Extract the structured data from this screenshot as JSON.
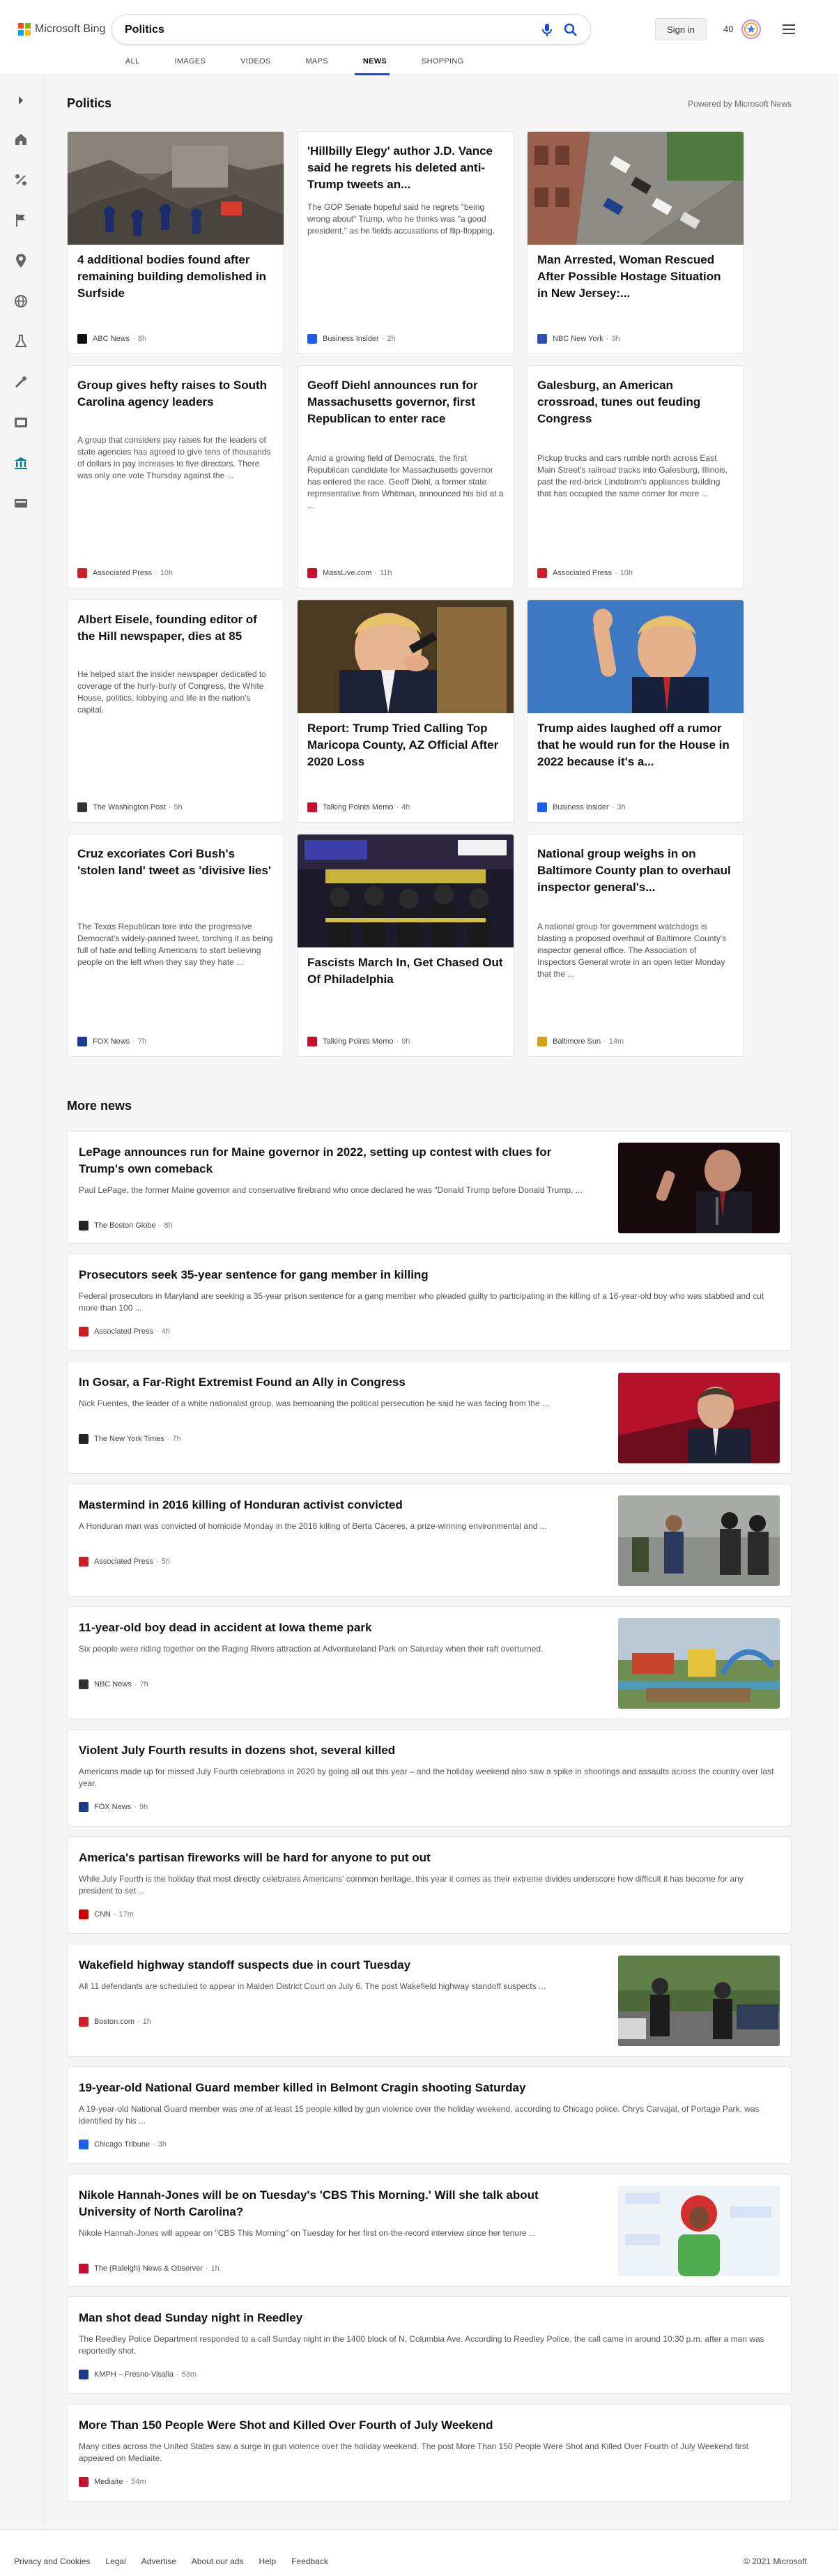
{
  "brand": {
    "name": "Microsoft Bing",
    "logo_colors": [
      "#f25022",
      "#7fba00",
      "#00a4ef",
      "#ffb900"
    ]
  },
  "search": {
    "query": "Politics"
  },
  "header": {
    "signin_label": "Sign in",
    "points": "40"
  },
  "scopes": [
    {
      "label": "ALL"
    },
    {
      "label": "IMAGES"
    },
    {
      "label": "VIDEOS"
    },
    {
      "label": "MAPS"
    },
    {
      "label": "NEWS",
      "active": true
    },
    {
      "label": "SHOPPING"
    }
  ],
  "rail_icons": [
    "expand-icon",
    "home-icon",
    "politics-icon",
    "flag-icon",
    "location-icon",
    "globe-icon",
    "science-icon",
    "sports-icon",
    "entertainment-icon",
    "government-icon",
    "money-icon"
  ],
  "section": {
    "title": "Politics",
    "powered_by": "Powered by Microsoft News"
  },
  "cards": [
    {
      "title": "4 additional bodies found after remaining building demolished in Surfside",
      "snippet": "",
      "source": "ABC News",
      "time": "8h",
      "source_color": "#111111",
      "has_image": true,
      "image": "rubble"
    },
    {
      "title": "'Hillbilly Elegy' author J.D. Vance said he regrets his deleted anti-Trump tweets an...",
      "snippet": "The GOP Senate hopeful said he regrets \"being wrong about\" Trump, who he thinks was \"a good president,\" as he fields accusations of flip-flopping.",
      "source": "Business Insider",
      "time": "2h",
      "source_color": "#1a5ff0",
      "has_image": false
    },
    {
      "title": "Man Arrested, Woman Rescued After Possible Hostage Situation in New Jersey:...",
      "snippet": "",
      "source": "NBC New York",
      "time": "3h",
      "source_color": "#2c4fb6",
      "has_image": true,
      "image": "street"
    },
    {
      "title": "Group gives hefty raises to South Carolina agency leaders",
      "snippet": "A group that considers pay raises for the leaders of state agencies has agreed to give tens of thousands of dollars in pay increases to five directors. There was only one vote Thursday against the ...",
      "source": "Associated Press",
      "time": "10h",
      "source_color": "#d11f2a",
      "has_image": false
    },
    {
      "title": "Geoff Diehl announces run for Massachusetts governor, first Republican to enter race",
      "snippet": "Amid a growing field of Democrats, the first Republican candidate for Massachusetts governor has entered the race. Geoff Diehl, a former state representative from Whitman, announced his bid at a ...",
      "source": "MassLive.com",
      "time": "11h",
      "source_color": "#c8102e",
      "has_image": false
    },
    {
      "title": "Galesburg, an American crossroad, tunes out feuding Congress",
      "snippet": "Pickup trucks and cars rumble north across East Main Street's railroad tracks into Galesburg, Illinois, past the red-brick Lindstrom's appliances building that has occupied the same corner for more ...",
      "source": "Associated Press",
      "time": "10h",
      "source_color": "#d11f2a",
      "has_image": false
    },
    {
      "title": "Albert Eisele, founding editor of the Hill newspaper, dies at 85",
      "snippet": "He helped start the insider newspaper dedicated to coverage of the hurly-burly of Congress, the White House, politics, lobbying and life in the nation's capital.",
      "source": "The Washington Post",
      "time": "5h",
      "source_color": "#333333",
      "has_image": false
    },
    {
      "title": "Report: Trump Tried Calling Top Maricopa County, AZ Official After 2020 Loss",
      "snippet": "",
      "source": "Talking Points Memo",
      "time": "4h",
      "source_color": "#c8102e",
      "has_image": true,
      "image": "phone"
    },
    {
      "title": "Trump aides laughed off a rumor that he would run for the House in 2022 because it's a...",
      "snippet": "",
      "source": "Business Insider",
      "time": "3h",
      "source_color": "#1a5ff0",
      "has_image": true,
      "image": "wave"
    },
    {
      "title": "Cruz excoriates Cori Bush's 'stolen land' tweet as 'divisive lies'",
      "snippet": "The Texas Republican tore into the progressive Democrat's widely-panned tweet, torching it as being full of hate and telling Americans to start believing people on the left when they say they hate ...",
      "source": "FOX News",
      "time": "7h",
      "source_color": "#1a3c8f",
      "has_image": false
    },
    {
      "title": "Fascists March In, Get Chased Out Of Philadelphia",
      "snippet": "",
      "source": "Talking Points Memo",
      "time": "9h",
      "source_color": "#c8102e",
      "has_image": true,
      "image": "march"
    },
    {
      "title": "National group weighs in on Baltimore County plan to overhaul inspector general's...",
      "snippet": "A national group for government watchdogs is blasting a proposed overhaul of Baltimore County's inspector general office. The Association of Inspectors General wrote in an open letter Monday that the ...",
      "source": "Baltimore Sun",
      "time": "14m",
      "source_color": "#d4a017",
      "has_image": false
    }
  ],
  "more_news": {
    "title": "More news"
  },
  "news": [
    {
      "title": "LePage announces run for Maine governor in 2022, setting up contest with clues for Trump's own comeback",
      "snippet": "Paul LePage, the former Maine governor and conservative firebrand who once declared he was \"Donald Trump before Donald Trump, ...",
      "source": "The Boston Globe",
      "time": "8h",
      "source_color": "#222222",
      "image": "speaker"
    },
    {
      "title": "Prosecutors seek 35-year sentence for gang member in killing",
      "snippet": "Federal prosecutors in Maryland are seeking a 35-year prison sentence for a gang member who pleaded guilty to participating in the killing of a 16-year-old boy who was stabbed and cut more than 100 ...",
      "source": "Associated Press",
      "time": "4h",
      "source_color": "#d11f2a",
      "image": ""
    },
    {
      "title": "In Gosar, a Far-Right Extremist Found an Ally in Congress",
      "snippet": "Nick Fuentes, the leader of a white nationalist group, was bemoaning the political persecution he said he was facing from the ...",
      "source": "The New York Times",
      "time": "7h",
      "source_color": "#222222",
      "image": "gosar"
    },
    {
      "title": "Mastermind in 2016 killing of Honduran activist convicted",
      "snippet": "A Honduran man was convicted of homicide Monday in the 2016 killing of Berta Cáceres, a prize-winning environmental and ...",
      "source": "Associated Press",
      "time": "5h",
      "source_color": "#d11f2a",
      "image": "honduras"
    },
    {
      "title": "11-year-old boy dead in accident at Iowa theme park",
      "snippet": "Six people were riding together on the Raging Rivers attraction at Adventureland Park on Saturday when their raft overturned.",
      "source": "NBC News",
      "time": "7h",
      "source_color": "#333333",
      "image": "park"
    },
    {
      "title": "Violent July Fourth results in dozens shot, several killed",
      "snippet": "Americans made up for missed July Fourth celebrations in 2020 by going all out this year – and the holiday weekend also saw a spike in shootings and assaults across the country over last year.",
      "source": "FOX News",
      "time": "9h",
      "source_color": "#1a3c8f",
      "image": ""
    },
    {
      "title": "America's partisan fireworks will be hard for anyone to put out",
      "snippet": "While July Fourth is the holiday that most directly celebrates Americans' common heritage, this year it comes as their extreme divides underscore how difficult it has become for any president to set ...",
      "source": "CNN",
      "time": "17m",
      "source_color": "#cc0000",
      "image": ""
    },
    {
      "title": "Wakefield highway standoff suspects due in court Tuesday",
      "snippet": "All 11 defendants are scheduled to appear in Malden District Court on July 6. The post Wakefield highway standoff suspects ...",
      "source": "Boston.com",
      "time": "1h",
      "source_color": "#d11f2a",
      "image": "standoff"
    },
    {
      "title": "19-year-old National Guard member killed in Belmont Cragin shooting Saturday",
      "snippet": "A 19-year-old National Guard member was one of at least 15 people killed by gun violence over the holiday weekend, according to Chicago police. Chrys Carvajal, of Portage Park, was identified by his ...",
      "source": "Chicago Tribune",
      "time": "3h",
      "source_color": "#1a5ff0",
      "image": ""
    },
    {
      "title": "Nikole Hannah-Jones will be on Tuesday's 'CBS This Morning.' Will she talk about University of North Carolina?",
      "snippet": "Nikole Hannah-Jones will appear on \"CBS This Morning\" on Tuesday for her first on-the-record interview since her tenure ...",
      "source": "The (Raleigh) News & Observer",
      "time": "1h",
      "source_color": "#c8102e",
      "image": "indeed"
    },
    {
      "title": "Man shot dead Sunday night in Reedley",
      "snippet": "The Reedley Police Department responded to a call Sunday night in the 1400 block of N. Columbia Ave. According to Reedley Police, the call came in around 10:30 p.m. after a man was reportedly shot.",
      "source": "KMPH – Fresno-Visalia",
      "time": "53m",
      "source_color": "#1a3c8f",
      "image": ""
    },
    {
      "title": "More Than 150 People Were Shot and Killed Over Fourth of July Weekend",
      "snippet": "Many cities across the United States saw a surge in gun violence over the holiday weekend. The post More Than 150 People Were Shot and Killed Over Fourth of July Weekend first appeared on Mediaite.",
      "source": "Mediaite",
      "time": "54m",
      "source_color": "#c8102e",
      "image": ""
    }
  ],
  "footer": {
    "links": [
      "Privacy and Cookies",
      "Legal",
      "Advertise",
      "About our ads",
      "Help",
      "Feedback"
    ],
    "copyright": "© 2021 Microsoft"
  },
  "accent_color": "#174ae4"
}
